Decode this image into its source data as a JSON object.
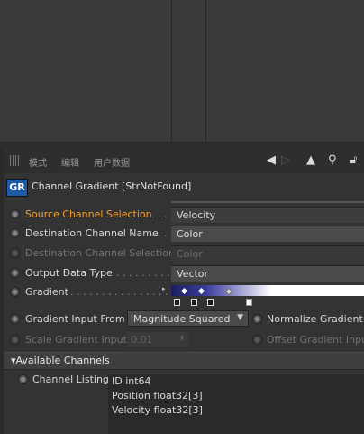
{
  "toolbar": {
    "menu": [
      "模式",
      "编辑",
      "用户数据"
    ],
    "icons": [
      "back-arrow-icon",
      "forward-arrow-icon",
      "up-arrow-icon",
      "search-icon",
      "lock-icon"
    ]
  },
  "header": {
    "logo": "GR",
    "title": "Channel Gradient [StrNotFound]"
  },
  "params": {
    "source_label": "Source Channel Selection",
    "source_dots": " . . . .",
    "source_value": "Velocity",
    "dest_label": "Destination Channel Name",
    "dest_dots": " . . .",
    "dest_value": "Color",
    "dest_sel_label": "Destination Channel Selection",
    "dest_sel_value": "Color",
    "output_label": "Output Data Type",
    "output_dots": " . . . . . . . . . . .",
    "output_value": "Vector",
    "gradient_label": "Gradient",
    "gradient_dots": " . . . . . . . . . . . . . . . . .",
    "grad_input_label": "Gradient Input From",
    "grad_input_value": "Magnitude Squared",
    "normalize_label": "Normalize Gradient I",
    "scale_label": "Scale Gradient Input",
    "scale_value": "0.01",
    "offset_label": "Offset Gradient Inpu"
  },
  "section": {
    "title": "Available Channels"
  },
  "channels": {
    "label": "Channel Listing",
    "items": [
      "ID int64",
      "Position float32[3]",
      "Velocity float32[3]"
    ]
  },
  "colors": {
    "accent_orange": "#f0a030",
    "logo_blue": "#1e5aa8"
  }
}
